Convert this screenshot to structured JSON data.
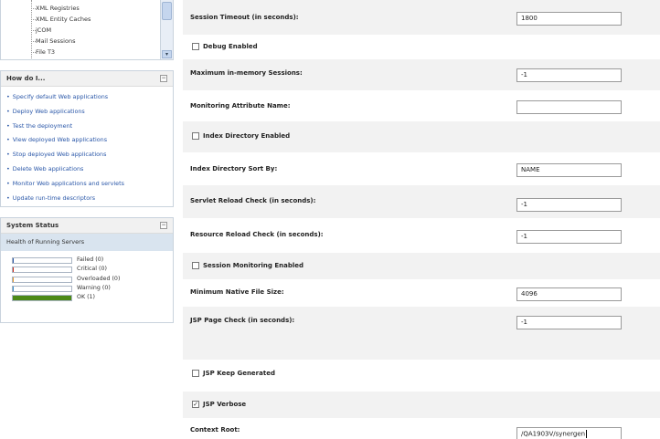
{
  "tree": {
    "items": [
      "XML Registries",
      "XML Entity Caches",
      "jCOM",
      "Mail Sessions",
      "File T3"
    ]
  },
  "howdo": {
    "title": "How do I...",
    "items": [
      "Specify default Web applications",
      "Deploy Web applications",
      "Test the deployment",
      "View deployed Web applications",
      "Stop deployed Web applications",
      "Delete Web applications",
      "Monitor Web applications and servlets",
      "Update run-time descriptors"
    ]
  },
  "system_status": {
    "title": "System Status",
    "subtitle": "Health of Running Servers",
    "rows": [
      {
        "label": "Failed (0)",
        "fill": 0.02,
        "color": "#2a57a8"
      },
      {
        "label": "Critical (0)",
        "fill": 0.02,
        "color": "#cc2a1d"
      },
      {
        "label": "Overloaded (0)",
        "fill": 0.02,
        "color": "#e69a2e"
      },
      {
        "label": "Warning (0)",
        "fill": 0.02,
        "color": "#3a8fc9"
      },
      {
        "label": "OK (1)",
        "fill": 1.0,
        "color": "#4d8a17"
      }
    ]
  },
  "form": {
    "session_timeout": {
      "label": "Session Timeout (in seconds):",
      "value": "1800"
    },
    "debug_enabled": {
      "label": "Debug Enabled",
      "checked": false
    },
    "max_sessions": {
      "label": "Maximum in-memory Sessions:",
      "value": "-1"
    },
    "monitoring_attr": {
      "label": "Monitoring Attribute Name:",
      "value": ""
    },
    "index_dir_enabled": {
      "label": "Index Directory Enabled",
      "checked": false
    },
    "index_dir_sort": {
      "label": "Index Directory Sort By:",
      "value": "NAME"
    },
    "servlet_reload": {
      "label": "Servlet Reload Check (in seconds):",
      "value": "-1"
    },
    "resource_reload": {
      "label": "Resource Reload Check (in seconds):",
      "value": "-1"
    },
    "session_monitoring": {
      "label": "Session Monitoring Enabled",
      "checked": false
    },
    "min_native_file": {
      "label": "Minimum Native File Size:",
      "value": "4096"
    },
    "jsp_page_check": {
      "label": "JSP Page Check (in seconds):",
      "value": "-1"
    },
    "jsp_keep_generated": {
      "label": "JSP Keep Generated",
      "checked": false
    },
    "jsp_verbose": {
      "label": "JSP Verbose",
      "checked": true
    },
    "context_root": {
      "label": "Context Root:",
      "value": "/QA1903V/synergen"
    }
  },
  "colors": {
    "link": "#2a57a8",
    "row_shade": "#f2f2f2",
    "status_header": "#d9e4ef"
  }
}
